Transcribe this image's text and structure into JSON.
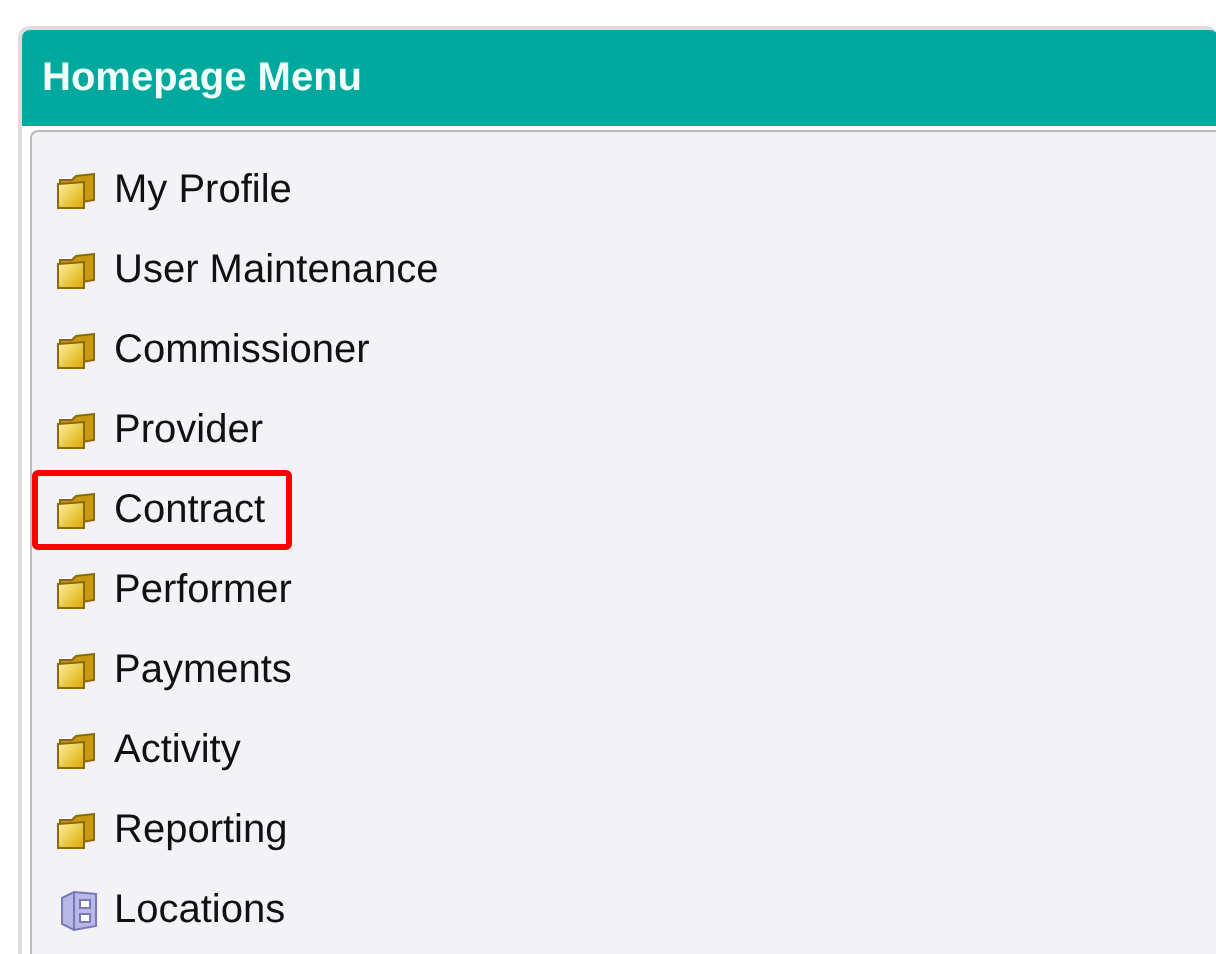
{
  "panel": {
    "title": "Homepage Menu",
    "items": [
      {
        "label": "My Profile",
        "kind": "folder",
        "highlighted": false
      },
      {
        "label": "User Maintenance",
        "kind": "folder",
        "highlighted": false
      },
      {
        "label": "Commissioner",
        "kind": "folder",
        "highlighted": false
      },
      {
        "label": "Provider",
        "kind": "folder",
        "highlighted": false
      },
      {
        "label": "Contract",
        "kind": "folder",
        "highlighted": true
      },
      {
        "label": "Performer",
        "kind": "folder",
        "highlighted": false
      },
      {
        "label": "Payments",
        "kind": "folder",
        "highlighted": false
      },
      {
        "label": "Activity",
        "kind": "folder",
        "highlighted": false
      },
      {
        "label": "Reporting",
        "kind": "folder",
        "highlighted": false
      },
      {
        "label": "Locations",
        "kind": "cabinet",
        "highlighted": false
      }
    ]
  }
}
